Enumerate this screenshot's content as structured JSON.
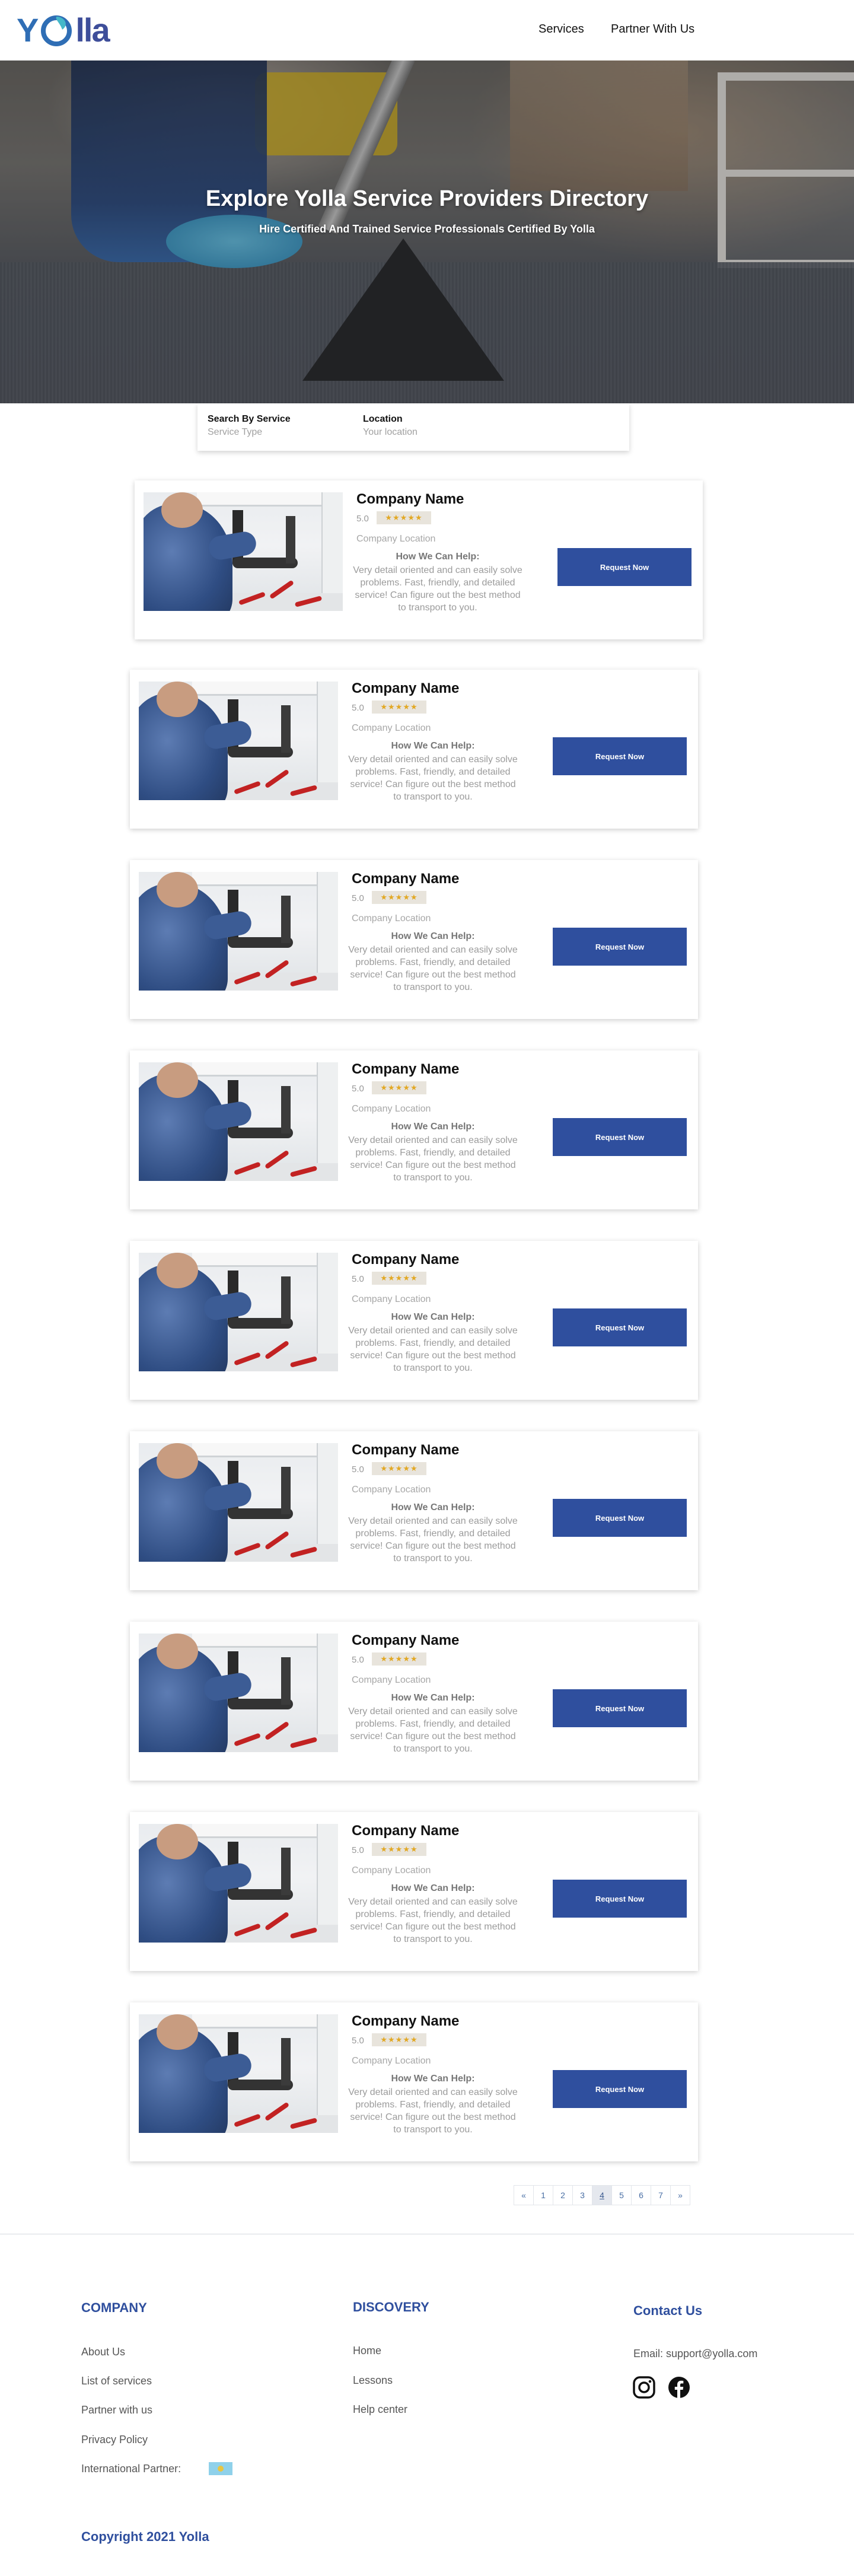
{
  "brand": {
    "logo_y": "Y",
    "logo_rest": "lla",
    "colors": {
      "primary": "#2f4f9e",
      "logo_blue": "#2f6eb5",
      "logo_teal": "#45b8c9",
      "star": "#e2a824"
    }
  },
  "nav": {
    "services": "Services",
    "partner": "Partner With Us"
  },
  "hero": {
    "title": "Explore Yolla Service Providers Directory",
    "subtitle": "Hire Certified And Trained Service Professionals Certified By Yolla"
  },
  "search": {
    "service_label": "Search By Service",
    "service_placeholder": "Service Type",
    "location_label": "Location",
    "location_placeholder": "Your location"
  },
  "providers": [
    {
      "name": "Company Name",
      "rating": "5.0",
      "stars": "★★★★★",
      "location": "Company Location",
      "help_heading": "How We Can Help:",
      "help_text": "Very detail oriented and can easily solve problems. Fast, friendly, and detailed service! Can figure out the best method to transport to you.",
      "button": "Request Now"
    },
    {
      "name": "Company Name",
      "rating": "5.0",
      "stars": "★★★★★",
      "location": "Company Location",
      "help_heading": "How We Can Help:",
      "help_text": "Very detail oriented and can easily solve problems. Fast, friendly, and detailed service! Can figure out the best method to transport to you.",
      "button": "Request Now"
    },
    {
      "name": "Company Name",
      "rating": "5.0",
      "stars": "★★★★★",
      "location": "Company Location",
      "help_heading": "How We Can Help:",
      "help_text": "Very detail oriented and can easily solve problems. Fast, friendly, and detailed service! Can figure out the best method to transport to you.",
      "button": "Request Now"
    },
    {
      "name": "Company Name",
      "rating": "5.0",
      "stars": "★★★★★",
      "location": "Company Location",
      "help_heading": "How We Can Help:",
      "help_text": "Very detail oriented and can easily solve problems. Fast, friendly, and detailed service! Can figure out the best method to transport to you.",
      "button": "Request Now"
    },
    {
      "name": "Company Name",
      "rating": "5.0",
      "stars": "★★★★★",
      "location": "Company Location",
      "help_heading": "How We Can Help:",
      "help_text": "Very detail oriented and can easily solve problems. Fast, friendly, and detailed service! Can figure out the best method to transport to you.",
      "button": "Request Now"
    },
    {
      "name": "Company Name",
      "rating": "5.0",
      "stars": "★★★★★",
      "location": "Company Location",
      "help_heading": "How We Can Help:",
      "help_text": "Very detail oriented and can easily solve problems. Fast, friendly, and detailed service! Can figure out the best method to transport to you.",
      "button": "Request Now"
    },
    {
      "name": "Company Name",
      "rating": "5.0",
      "stars": "★★★★★",
      "location": "Company Location",
      "help_heading": "How We Can Help:",
      "help_text": "Very detail oriented and can easily solve problems. Fast, friendly, and detailed service! Can figure out the best method to transport to you.",
      "button": "Request Now"
    },
    {
      "name": "Company Name",
      "rating": "5.0",
      "stars": "★★★★★",
      "location": "Company Location",
      "help_heading": "How We Can Help:",
      "help_text": "Very detail oriented and can easily solve problems. Fast, friendly, and detailed service! Can figure out the best method to transport to you.",
      "button": "Request Now"
    },
    {
      "name": "Company Name",
      "rating": "5.0",
      "stars": "★★★★★",
      "location": "Company Location",
      "help_heading": "How We Can Help:",
      "help_text": "Very detail oriented and can easily solve problems. Fast, friendly, and detailed service! Can figure out the best method to transport to you.",
      "button": "Request Now"
    }
  ],
  "pagination": {
    "prev": "«",
    "pages": [
      "1",
      "2",
      "3",
      "4",
      "5",
      "6",
      "7"
    ],
    "current": "4",
    "next": "»"
  },
  "footer": {
    "company_heading": "COMPANY",
    "company_links": [
      "About Us",
      "List of services",
      "Partner with us",
      "Privacy Policy",
      "International Partner:"
    ],
    "discovery_heading": "DISCOVERY",
    "discovery_links": [
      "Home",
      "Lessons",
      "Help center"
    ],
    "contact_heading": "Contact Us",
    "email": "Email: support@yolla.com",
    "social_icons": [
      "instagram-icon",
      "facebook-icon"
    ],
    "copyright": "Copyright 2021 Yolla"
  }
}
